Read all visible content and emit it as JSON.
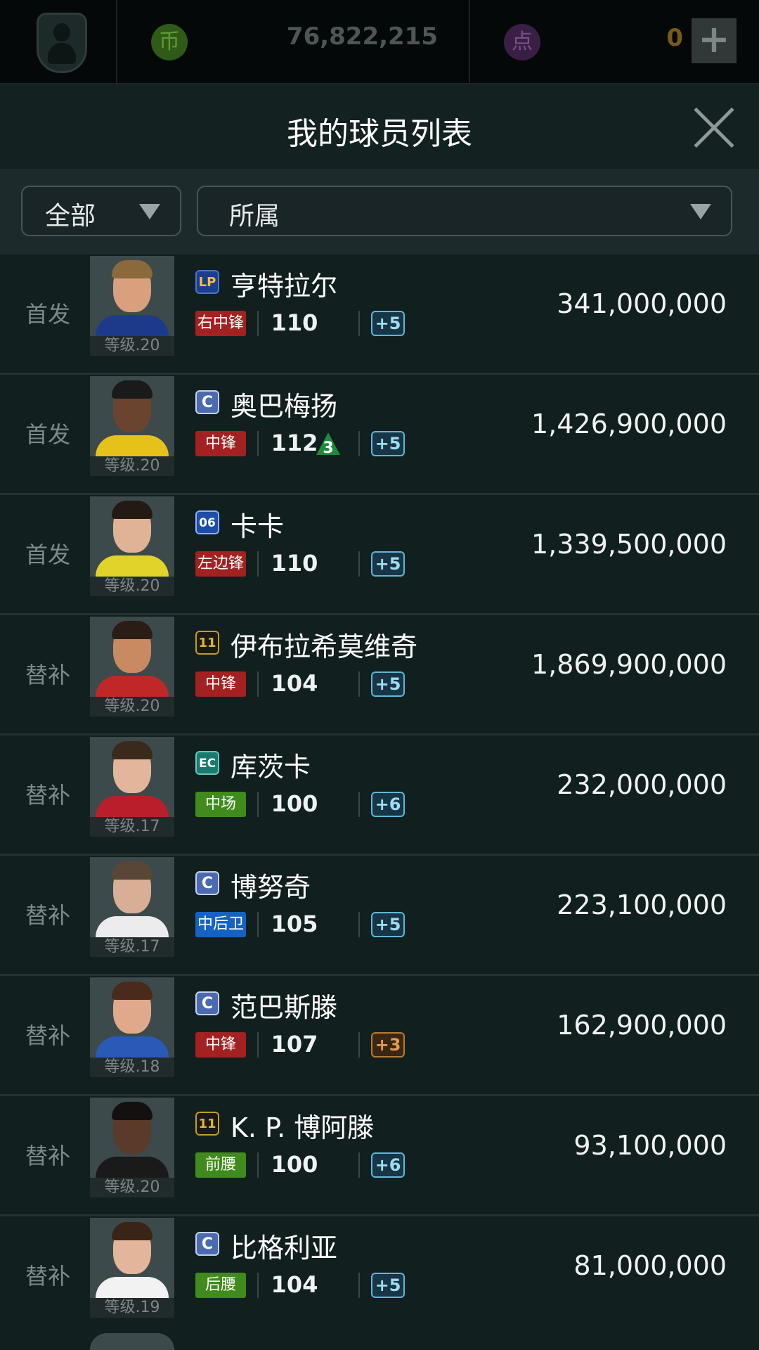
{
  "topbar": {
    "coin_icon": "币",
    "coins": "76,822,215",
    "point_icon": "点",
    "points": "0",
    "add_icon": "+"
  },
  "header": {
    "title": "我的球员列表"
  },
  "filters": {
    "category": "全部",
    "team": "所属"
  },
  "players": [
    {
      "status": "首发",
      "grade_icon": "LP",
      "grade_class": "grade-lp",
      "name": "亨特拉尔",
      "position": "右中锋",
      "pos_color": "red",
      "ovr": "110",
      "up": "",
      "boost": "+5",
      "boost_color": "blue",
      "level": "等级.20",
      "price": "341,000,000",
      "skin": "#d9a07e",
      "hair": "#8a6a3a",
      "shirt": "#1d3a8a"
    },
    {
      "status": "首发",
      "grade_icon": "C",
      "grade_class": "grade-c",
      "name": "奥巴梅扬",
      "position": "中锋",
      "pos_color": "red",
      "ovr": "112",
      "up": "3",
      "boost": "+5",
      "boost_color": "blue",
      "level": "等级.20",
      "price": "1,426,900,000",
      "skin": "#6b4430",
      "hair": "#1a1a1a",
      "shirt": "#e4c21a"
    },
    {
      "status": "首发",
      "grade_icon": "06",
      "grade_class": "grade-06",
      "name": "卡卡",
      "position": "左边锋",
      "pos_color": "red",
      "ovr": "110",
      "up": "",
      "boost": "+5",
      "boost_color": "blue",
      "level": "等级.20",
      "price": "1,339,500,000",
      "skin": "#e0b394",
      "hair": "#231a14",
      "shirt": "#e2d32a"
    },
    {
      "status": "替补",
      "grade_icon": "11",
      "grade_class": "grade-11",
      "name": "伊布拉希莫维奇",
      "position": "中锋",
      "pos_color": "red",
      "ovr": "104",
      "up": "",
      "boost": "+5",
      "boost_color": "blue",
      "level": "等级.20",
      "price": "1,869,900,000",
      "skin": "#c98a62",
      "hair": "#2a1d15",
      "shirt": "#c02828"
    },
    {
      "status": "替补",
      "grade_icon": "EC",
      "grade_class": "grade-ec",
      "name": "库茨卡",
      "position": "中场",
      "pos_color": "green",
      "ovr": "100",
      "up": "",
      "boost": "+6",
      "boost_color": "blue",
      "level": "等级.17",
      "price": "232,000,000",
      "skin": "#e3b59a",
      "hair": "#3a2a1c",
      "shirt": "#b81f2a"
    },
    {
      "status": "替补",
      "grade_icon": "C",
      "grade_class": "grade-c",
      "name": "博努奇",
      "position": "中后卫",
      "pos_color": "blue",
      "ovr": "105",
      "up": "",
      "boost": "+5",
      "boost_color": "blue",
      "level": "等级.17",
      "price": "223,100,000",
      "skin": "#d8ae94",
      "hair": "#5a4636",
      "shirt": "#ececec"
    },
    {
      "status": "替补",
      "grade_icon": "C",
      "grade_class": "grade-c",
      "name": "范巴斯滕",
      "position": "中锋",
      "pos_color": "red",
      "ovr": "107",
      "up": "",
      "boost": "+3",
      "boost_color": "orange",
      "level": "等级.18",
      "price": "162,900,000",
      "skin": "#e1a98c",
      "hair": "#4a2a1a",
      "shirt": "#2a5ab8"
    },
    {
      "status": "替补",
      "grade_icon": "11",
      "grade_class": "grade-11",
      "name": "K. P. 博阿滕",
      "position": "前腰",
      "pos_color": "green",
      "ovr": "100",
      "up": "",
      "boost": "+6",
      "boost_color": "blue",
      "level": "等级.20",
      "price": "93,100,000",
      "skin": "#5a3a28",
      "hair": "#141010",
      "shirt": "#1a1a1a"
    },
    {
      "status": "替补",
      "grade_icon": "C",
      "grade_class": "grade-c",
      "name": "比格利亚",
      "position": "后腰",
      "pos_color": "green",
      "ovr": "104",
      "up": "",
      "boost": "+5",
      "boost_color": "blue",
      "level": "等级.19",
      "price": "81,000,000",
      "skin": "#e3b59a",
      "hair": "#3a2416",
      "shirt": "#f2f2f2"
    }
  ]
}
